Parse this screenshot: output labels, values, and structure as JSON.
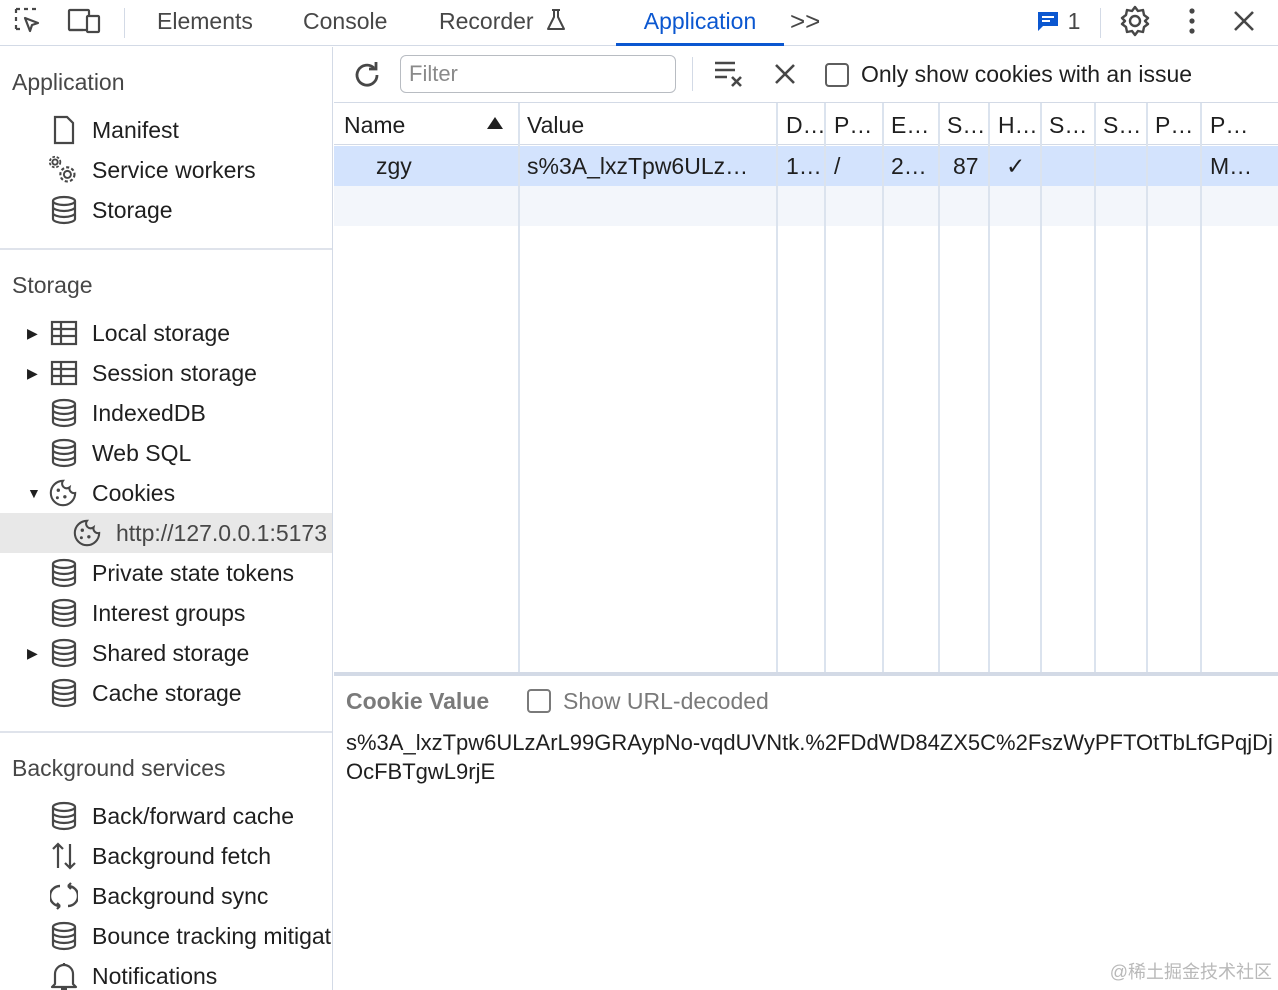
{
  "tabs": {
    "elements": "Elements",
    "console": "Console",
    "recorder": "Recorder",
    "application": "Application",
    "more": ">>"
  },
  "issues": {
    "count": "1"
  },
  "icons": {
    "inspect": "inspect-element-icon",
    "device": "device-toolbar-icon",
    "flask": "flask-icon",
    "issues": "message-icon",
    "settings": "gear-icon",
    "menu": "kebab-menu-icon",
    "close": "close-icon"
  },
  "colors": {
    "accent": "#0b57d0",
    "selected_row": "#d3e3fd"
  },
  "sidebar": {
    "application": {
      "title": "Application",
      "items": [
        "Manifest",
        "Service workers",
        "Storage"
      ]
    },
    "storage": {
      "title": "Storage",
      "items": [
        "Local storage",
        "Session storage",
        "IndexedDB",
        "Web SQL",
        "Cookies",
        "http://127.0.0.1:5173",
        "Private state tokens",
        "Interest groups",
        "Shared storage",
        "Cache storage"
      ]
    },
    "background": {
      "title": "Background services",
      "items": [
        "Back/forward cache",
        "Background fetch",
        "Background sync",
        "Bounce tracking mitigations",
        "Notifications"
      ]
    }
  },
  "toolbar": {
    "filter_placeholder": "Filter",
    "only_issues_label": "Only show cookies with an issue"
  },
  "table": {
    "headers": [
      "Name",
      "Value",
      "D…",
      "P…",
      "E…",
      "S…",
      "H…",
      "S…",
      "S…",
      "P…",
      "P…"
    ],
    "sorted_column": "Name",
    "sort_direction": "ascending",
    "rows": [
      {
        "name": "zgy",
        "value": "s%3A_lxzTpw6ULz…",
        "domain": "1…",
        "path": "/",
        "expires": "2…",
        "size": "87",
        "httponly": "✓",
        "secure": "",
        "samesite": "",
        "partition_key": "",
        "priority": "M…"
      }
    ]
  },
  "cookie_value": {
    "title": "Cookie Value",
    "show_decoded_label": "Show URL-decoded",
    "text": "s%3A_lxzTpw6ULzArL99GRAypNo-vqdUVNtk.%2FDdWD84ZX5C%2FszWyPFTOtTbLfGPqjDjOcFBTgwL9rjE"
  },
  "watermark": "@稀土掘金技术社区"
}
